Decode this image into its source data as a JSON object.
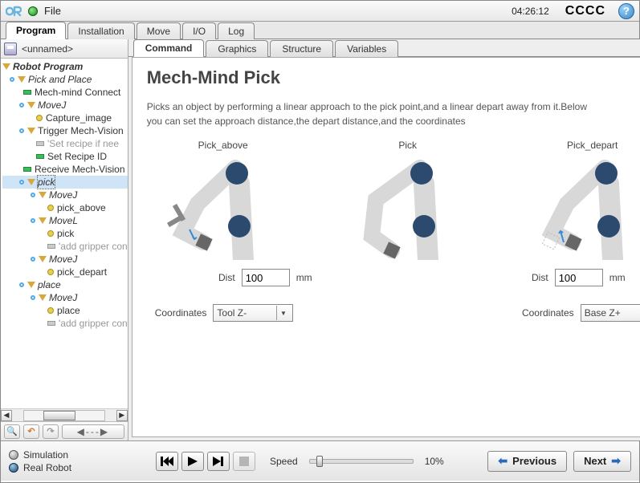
{
  "menubar": {
    "file": "File"
  },
  "clock": "04:26:12",
  "status_text": "CCCC",
  "main_tabs": {
    "program": "Program",
    "installation": "Installation",
    "move": "Move",
    "io": "I/O",
    "log": "Log"
  },
  "program_name": "<unnamed>",
  "tree": {
    "root": "Robot Program",
    "pick_and_place": "Pick and Place",
    "mech_connect": "Mech-mind Connect",
    "movej1": "MoveJ",
    "capture": "Capture_image",
    "trigger": "Trigger Mech-Vision",
    "set_recipe_comment": "'Set recipe if nee",
    "set_recipe_id": "Set Recipe ID",
    "receive": "Receive Mech-Vision",
    "pick": "pick",
    "movej2": "MoveJ",
    "pick_above": "pick_above",
    "movel": "MoveL",
    "pick_wp": "pick",
    "add_gripper1": "'add gripper con",
    "movej3": "MoveJ",
    "pick_depart": "pick_depart",
    "place": "place",
    "movej4": "MoveJ",
    "place_wp": "place",
    "add_gripper2": "'add gripper con"
  },
  "sub_tabs": {
    "command": "Command",
    "graphics": "Graphics",
    "structure": "Structure",
    "variables": "Variables"
  },
  "panel": {
    "title": "Mech-Mind Pick",
    "description": "Picks an object by performing a linear approach to the pick point,and a linear depart away from it.Below you can set the approach distance,the depart distance,and the coordinates",
    "col1_title": "Pick_above",
    "col2_title": "Pick",
    "col3_title": "Pick_depart",
    "dist_label": "Dist",
    "mm": "mm",
    "dist1_value": "100",
    "dist2_value": "100",
    "coord_label": "Coordinates",
    "coord1_value": "Tool Z-",
    "coord2_value": "Base Z+"
  },
  "bottom": {
    "simulation": "Simulation",
    "real_robot": "Real Robot",
    "speed_label": "Speed",
    "speed_pct": "10%",
    "previous": "Previous",
    "next": "Next"
  }
}
